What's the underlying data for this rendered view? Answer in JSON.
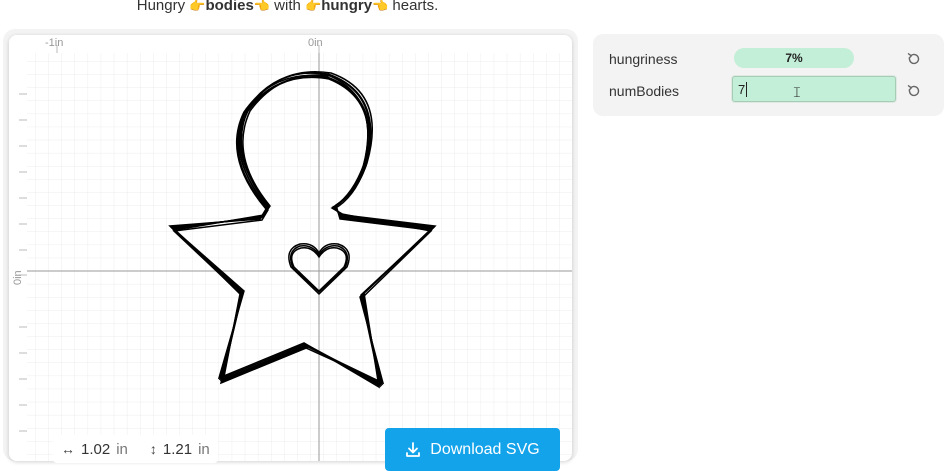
{
  "headline": {
    "word1": "Hungry",
    "word2": "bodies",
    "word3": "with",
    "word4": "hungry",
    "word5": "hearts."
  },
  "canvas": {
    "axis_top_left": "-1in",
    "axis_top_center": "0in",
    "axis_left_center": "0in"
  },
  "dimensions": {
    "width_value": "1.02",
    "height_value": "1.21",
    "unit": "in"
  },
  "download_button": {
    "label": "Download SVG"
  },
  "params": [
    {
      "name": "hungriness",
      "value": "7%"
    },
    {
      "name": "numBodies",
      "value": "7"
    }
  ],
  "icons": {
    "hand": "backhand-index-pointing-right",
    "download": "download-icon",
    "reset": "reset-icon"
  },
  "colors": {
    "accent": "#13a3ea",
    "param_fill": "#c3eed7"
  }
}
